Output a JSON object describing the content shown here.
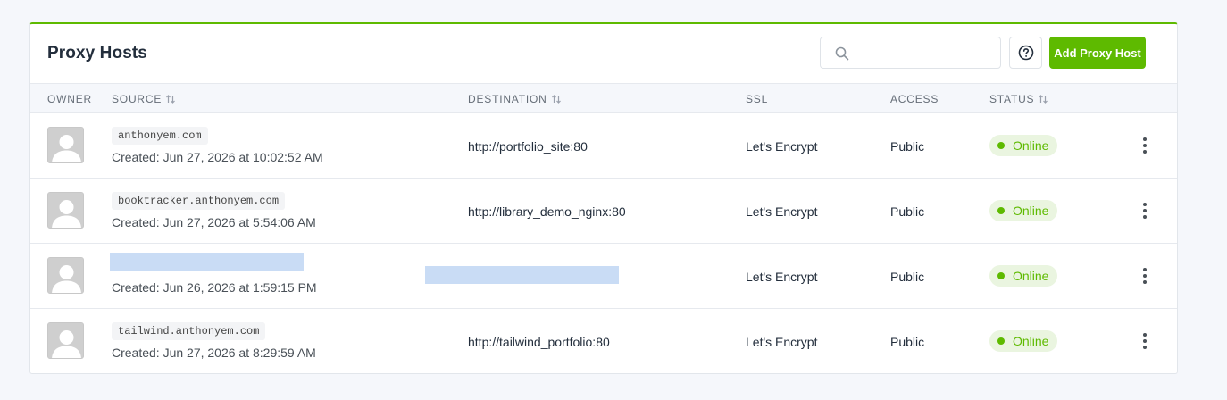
{
  "card": {
    "title": "Proxy Hosts",
    "search": {
      "value": "",
      "placeholder": ""
    },
    "add_button_label": "Add Proxy Host",
    "accent_color": "#5eba00"
  },
  "table": {
    "columns": {
      "owner": "OWNER",
      "source": "SOURCE",
      "destination": "DESTINATION",
      "ssl": "SSL",
      "access": "ACCESS",
      "status": "STATUS"
    },
    "rows": [
      {
        "source": "anthonyem.com",
        "created": "Created: Jun 27, 2026 at 10:02:52 AM",
        "destination": "http://portfolio_site:80",
        "ssl": "Let's Encrypt",
        "access": "Public",
        "status": "Online"
      },
      {
        "source": "booktracker.anthonyem.com",
        "created": "Created: Jun 27, 2026 at 5:54:06 AM",
        "destination": "http://library_demo_nginx:80",
        "ssl": "Let's Encrypt",
        "access": "Public",
        "status": "Online"
      },
      {
        "source": "",
        "created": "Created: Jun 26, 2026 at 1:59:15 PM",
        "destination": "",
        "ssl": "Let's Encrypt",
        "access": "Public",
        "status": "Online"
      },
      {
        "source": "tailwind.anthonyem.com",
        "created": "Created: Jun 27, 2026 at 8:29:59 AM",
        "destination": "http://tailwind_portfolio:80",
        "ssl": "Let's Encrypt",
        "access": "Public",
        "status": "Online"
      }
    ]
  }
}
